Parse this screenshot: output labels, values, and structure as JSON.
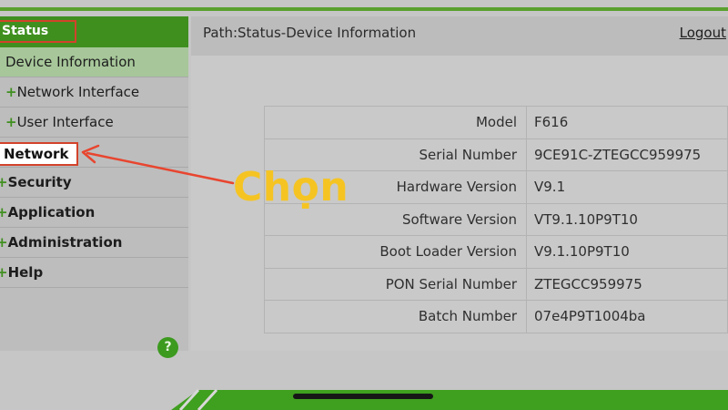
{
  "sidebar": {
    "status_label": "Status",
    "sub_items": [
      "Device Information",
      "Network Interface",
      "User Interface"
    ],
    "plus_glyph": "+",
    "network_label": "Network",
    "top_items": [
      "Security",
      "Application",
      "Administration",
      "Help"
    ],
    "help_icon_glyph": "?"
  },
  "header": {
    "path": "Path:Status-Device Information",
    "logout": "Logout"
  },
  "device_info": {
    "rows": [
      {
        "label": "Model",
        "value": "F616"
      },
      {
        "label": "Serial Number",
        "value": "9CE91C-ZTEGCC959975"
      },
      {
        "label": "Hardware Version",
        "value": "V9.1"
      },
      {
        "label": "Software Version",
        "value": "VT9.1.10P9T10"
      },
      {
        "label": "Boot Loader Version",
        "value": "V9.1.10P9T10"
      },
      {
        "label": "PON Serial Number",
        "value": "ZTEGCC959975"
      },
      {
        "label": "Batch Number",
        "value": "07e4P9T1004ba"
      }
    ]
  },
  "annotation": {
    "text": "Chọn",
    "text_color": "#f5c423",
    "arrow_color": "#e8452f"
  },
  "colors": {
    "brand_green": "#3f8f1f",
    "highlight_border": "#d2432b"
  }
}
